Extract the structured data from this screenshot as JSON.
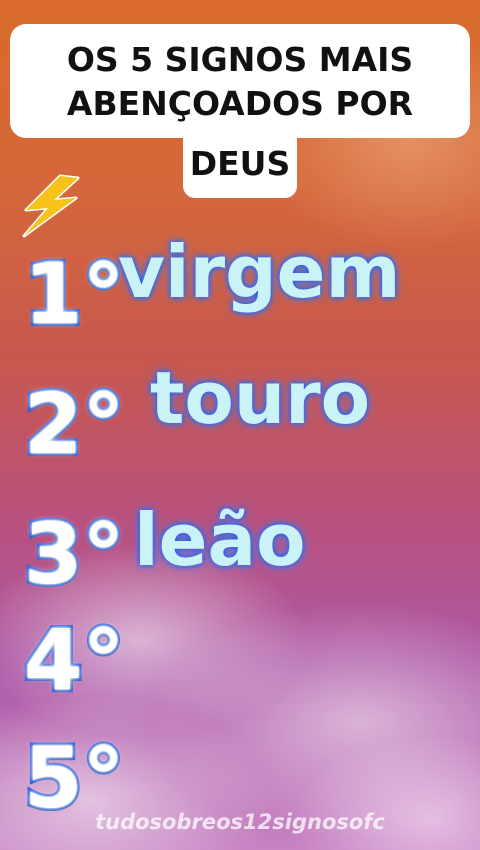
{
  "title": {
    "line1": "OS 5 SIGNOS MAIS",
    "line2": "ABENÇOADOS  POR",
    "line3": "DEUS"
  },
  "ranking": [
    {
      "rank": "1°",
      "sign": "virgem"
    },
    {
      "rank": "2°",
      "sign": "touro"
    },
    {
      "rank": "3°",
      "sign": "leão"
    },
    {
      "rank": "4°",
      "sign": ""
    },
    {
      "rank": "5°",
      "sign": ""
    }
  ],
  "watermark": "tudosobreos12signosofc",
  "colors": {
    "rank_outline": "#2a62e0",
    "sign_fill": "#c9f3f6",
    "sign_glow": "#2a52e8",
    "bolt": "#f7c21a"
  },
  "icons": {
    "bolt": "lightning-bolt-icon"
  }
}
